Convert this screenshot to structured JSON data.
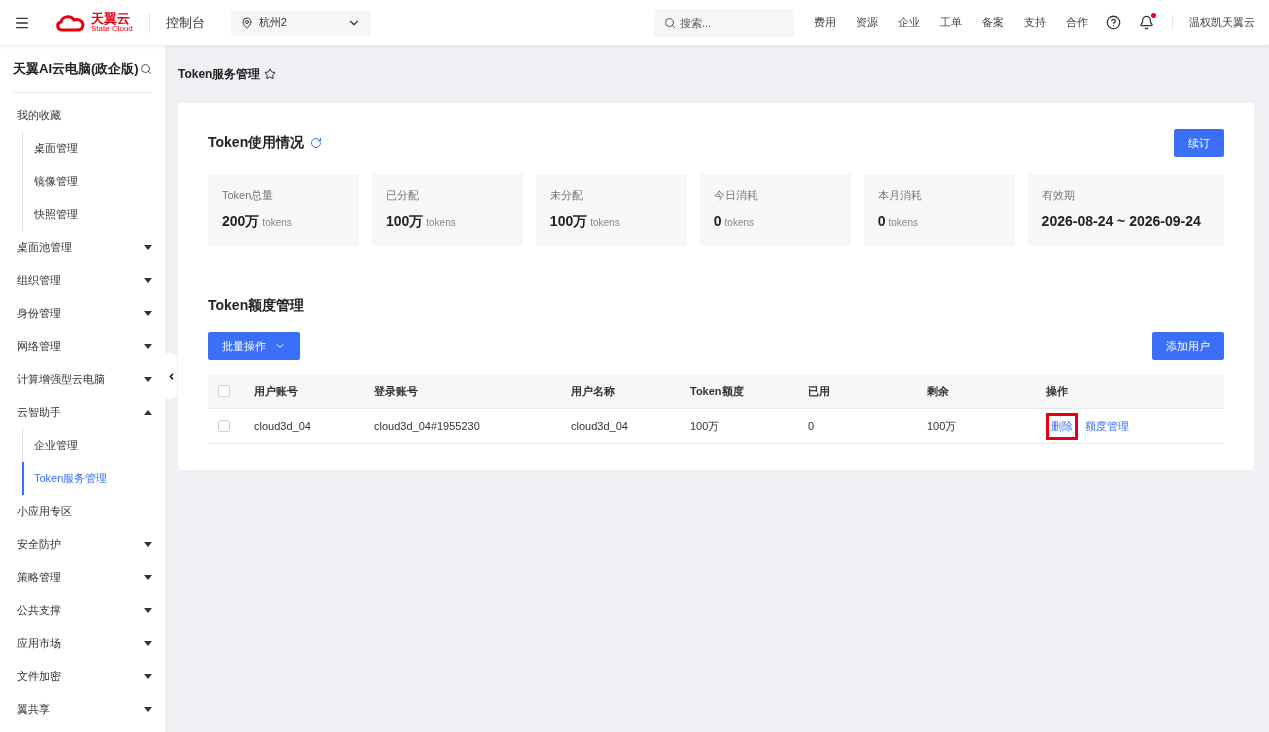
{
  "topbar": {
    "logo": {
      "name": "天翼云",
      "sub": "State Cloud"
    },
    "console": "控制台",
    "region": "杭州2",
    "search": {
      "placeholder": "搜索..."
    },
    "links": [
      "费用",
      "资源",
      "企业",
      "工单",
      "备案",
      "支持",
      "合作"
    ],
    "notification_dot": true,
    "user": "温权凯天翼云"
  },
  "sidebar": {
    "title": "天翼AI云电脑(政企版)",
    "groups": [
      {
        "label": "我的收藏",
        "kind": "plain",
        "children": [
          {
            "label": "桌面管理",
            "selected": false
          },
          {
            "label": "镜像管理",
            "selected": false
          },
          {
            "label": "快照管理",
            "selected": false
          }
        ]
      },
      {
        "label": "桌面池管理",
        "kind": "menu",
        "expanded": false
      },
      {
        "label": "组织管理",
        "kind": "menu",
        "expanded": false
      },
      {
        "label": "身份管理",
        "kind": "menu",
        "expanded": false
      },
      {
        "label": "网络管理",
        "kind": "menu",
        "expanded": false
      },
      {
        "label": "计算增强型云电脑",
        "kind": "menu",
        "expanded": false
      },
      {
        "label": "云智助手",
        "kind": "menu",
        "expanded": true,
        "children": [
          {
            "label": "企业管理",
            "selected": false
          },
          {
            "label": "Token服务管理",
            "selected": true
          }
        ]
      },
      {
        "label": "小应用专区",
        "kind": "plain"
      },
      {
        "label": "安全防护",
        "kind": "menu",
        "expanded": false
      },
      {
        "label": "策略管理",
        "kind": "menu",
        "expanded": false
      },
      {
        "label": "公共支撑",
        "kind": "menu",
        "expanded": false
      },
      {
        "label": "应用市场",
        "kind": "menu",
        "expanded": false
      },
      {
        "label": "文件加密",
        "kind": "menu",
        "expanded": false
      },
      {
        "label": "翼共享",
        "kind": "menu",
        "expanded": false
      }
    ]
  },
  "page": {
    "title": "Token服务管理",
    "usage": {
      "title": "Token使用情况",
      "renew_button": "续订",
      "stats": [
        {
          "label": "Token总量",
          "value": "200万",
          "unit": "tokens"
        },
        {
          "label": "已分配",
          "value": "100万",
          "unit": "tokens"
        },
        {
          "label": "未分配",
          "value": "100万",
          "unit": "tokens"
        },
        {
          "label": "今日消耗",
          "value": "0",
          "unit": "tokens"
        },
        {
          "label": "本月消耗",
          "value": "0",
          "unit": "tokens"
        },
        {
          "label": "有效期",
          "value": "2026-08-24 ~ 2026-09-24"
        }
      ]
    },
    "quota": {
      "title": "Token额度管理",
      "batch_button": "批量操作",
      "add_button": "添加用户",
      "table": {
        "columns": [
          "用户账号",
          "登录账号",
          "用户名称",
          "Token额度",
          "已用",
          "剩余",
          "操作"
        ],
        "all_checked": false,
        "rows": [
          {
            "checked": false,
            "cells": [
              "cloud3d_04",
              "cloud3d_04#1955230",
              "cloud3d_04",
              "100万",
              "0",
              "100万"
            ],
            "actions": [
              {
                "label": "删除",
                "highlighted": true
              },
              {
                "label": "额度管理",
                "highlighted": false
              }
            ]
          }
        ]
      }
    }
  }
}
